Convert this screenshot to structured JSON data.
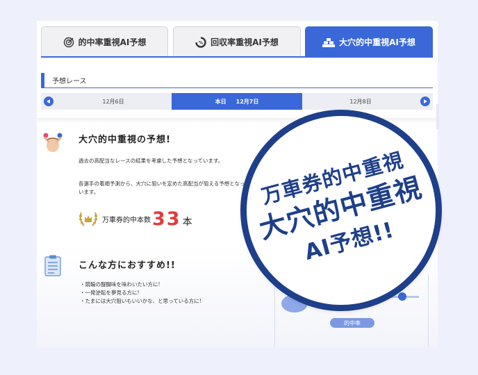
{
  "tabs": [
    {
      "label": "的中率重視AI予想",
      "icon": "target-icon",
      "active": false
    },
    {
      "label": "回収率重視AI予想",
      "icon": "percent-gauge-icon",
      "active": false
    },
    {
      "label": "大穴的中重視AI予想",
      "icon": "gold-bars-icon",
      "active": true
    }
  ],
  "section": {
    "title": "予想レース"
  },
  "dates": {
    "prev": "12月6日",
    "today_label": "本日",
    "today_date": "12月7日",
    "next": "12月8日"
  },
  "intro": {
    "title": "大穴的中重視の予想!",
    "paragraph1": "過去の高配当なレースの結果を考慮した予想となっています。",
    "paragraph2": "各選手の着順予測から、大穴に狙いを定めた高配当が狙える予想となっています。"
  },
  "hits": {
    "label": "万車券的中本数",
    "count": "33",
    "unit": "本"
  },
  "recommend": {
    "title": "こんな方におすすめ!!",
    "items": [
      "・競輪の醍醐味を味わいたい方に!",
      "・一発逆転を夢見る方に!",
      "・たまには大穴狙いもいいかな、と思っている方に!"
    ]
  },
  "side": {
    "pill_label": "的中率"
  },
  "badge": {
    "line1": "万車券的中重視",
    "line2": "大穴的中重視",
    "line3": "AI予想!!"
  },
  "colors": {
    "accent": "#3a68d8",
    "badge": "#1e3f8a",
    "number": "#e33a3a"
  }
}
